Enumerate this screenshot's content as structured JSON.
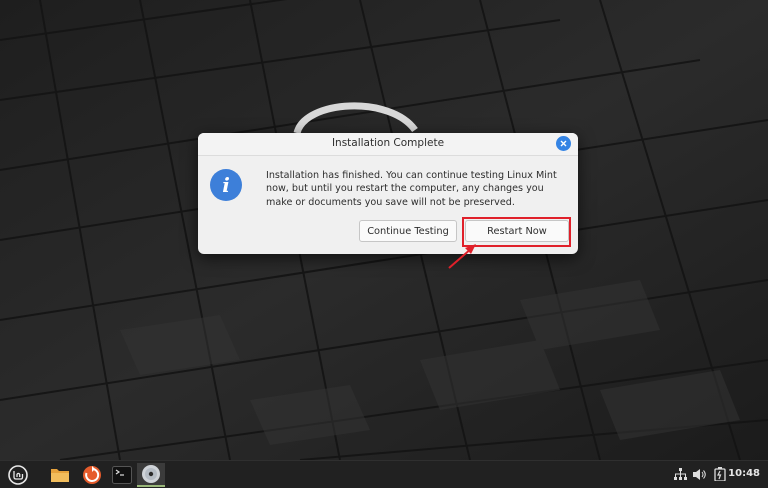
{
  "dialog": {
    "title": "Installation Complete",
    "icon": "info-icon",
    "message": "Installation has finished.  You can continue testing Linux Mint now, but until you restart the computer, any changes you make or documents you save will not be preserved.",
    "buttons": {
      "continue_label": "Continue Testing",
      "restart_label": "Restart Now"
    }
  },
  "taskbar": {
    "menu_icon": "linux-mint-menu-icon",
    "launchers": [
      "files-folder-icon",
      "update-manager-icon",
      "terminal-icon",
      "install-disc-icon"
    ],
    "tray": [
      "network-icon",
      "volume-icon",
      "battery-icon"
    ],
    "clock": "10:48"
  },
  "colors": {
    "accent": "#3584e4",
    "highlight": "#e0202a",
    "taskbar": "#212121"
  }
}
